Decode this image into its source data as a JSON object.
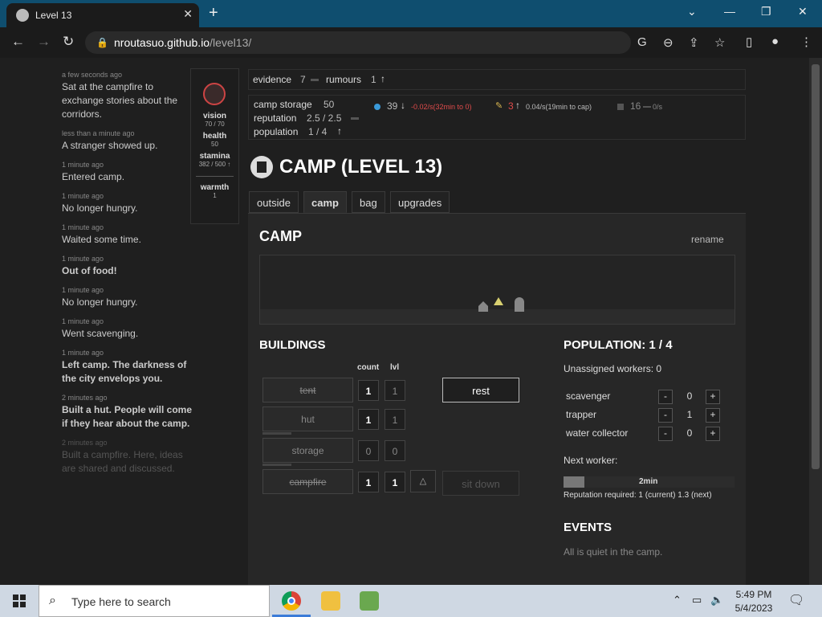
{
  "browser": {
    "tab_title": "Level 13",
    "url_host": "nroutasuo.github.io",
    "url_path": "/level13/"
  },
  "log": [
    {
      "time": "a few seconds ago",
      "text": "Sat at the campfire to exchange stories about the corridors.",
      "style": ""
    },
    {
      "time": "less than a minute ago",
      "text": "A stranger showed up.",
      "style": ""
    },
    {
      "time": "1 minute ago",
      "text": "Entered camp.",
      "style": ""
    },
    {
      "time": "1 minute ago",
      "text": "No longer hungry.",
      "style": ""
    },
    {
      "time": "1 minute ago",
      "text": "Waited some time.",
      "style": ""
    },
    {
      "time": "1 minute ago",
      "text": "Out of food!",
      "style": "bold"
    },
    {
      "time": "1 minute ago",
      "text": "No longer hungry.",
      "style": ""
    },
    {
      "time": "1 minute ago",
      "text": "Went scavenging.",
      "style": ""
    },
    {
      "time": "1 minute ago",
      "text": "Left camp. The darkness of the city envelops you.",
      "style": "bold"
    },
    {
      "time": "2 minutes ago",
      "text": "Built a hut. People will come if they hear about the camp.",
      "style": "bold"
    },
    {
      "time": "2 minutes ago",
      "text": "Built a campfire. Here, ideas are shared and discussed.",
      "style": "fade"
    }
  ],
  "stats": {
    "vision_label": "vision",
    "vision_val": "70 / 70",
    "health_label": "health",
    "health_val": "50",
    "stamina_label": "stamina",
    "stamina_val": "382 / 500",
    "warmth_label": "warmth",
    "warmth_val": "1"
  },
  "resources": {
    "evidence_label": "evidence",
    "evidence_val": "7",
    "rumours_label": "rumours",
    "rumours_val": "1",
    "storage_label": "camp storage",
    "storage_val": "50",
    "reputation_label": "reputation",
    "reputation_val": "2.5 / 2.5",
    "population_label": "population",
    "population_val": "1 / 4",
    "water_val": "39",
    "water_rate": "-0.02/s(32min to 0)",
    "food_val": "3",
    "food_rate": "0.04/s(19min to cap)",
    "metal_val": "16",
    "metal_rate": "0/s"
  },
  "camp": {
    "title": "CAMP (LEVEL 13)",
    "tabs": [
      "outside",
      "camp",
      "bag",
      "upgrades"
    ],
    "heading": "CAMP",
    "rename": "rename"
  },
  "buildings": {
    "heading": "BUILDINGS",
    "count_head": "count",
    "lvl_head": "lvl",
    "rows": [
      {
        "name": "tent",
        "count": "1",
        "lvl": "1"
      },
      {
        "name": "hut",
        "count": "1",
        "lvl": "1"
      },
      {
        "name": "storage",
        "count": "0",
        "lvl": "0"
      },
      {
        "name": "campfire",
        "count": "1",
        "lvl": "1"
      }
    ],
    "rest": "rest",
    "sit_down": "sit down"
  },
  "population": {
    "heading": "POPULATION: 1 / 4",
    "unassigned": "Unassigned workers: 0",
    "workers": [
      {
        "name": "scavenger",
        "count": "0"
      },
      {
        "name": "trapper",
        "count": "1"
      },
      {
        "name": "water collector",
        "count": "0"
      }
    ],
    "next_worker": "Next worker:",
    "next_time": "2min",
    "next_progress": 0.12,
    "reputation_req": "Reputation required: 1 (current) 1.3 (next)"
  },
  "events": {
    "heading": "EVENTS",
    "text": "All is quiet in the camp."
  },
  "taskbar": {
    "search_placeholder": "Type here to search",
    "time": "5:49 PM",
    "date": "5/4/2023"
  }
}
